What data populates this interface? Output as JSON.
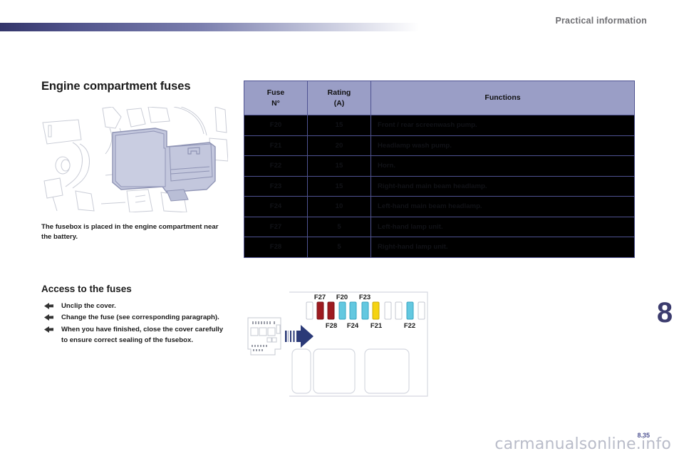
{
  "header": {
    "title": "Practical information"
  },
  "left": {
    "section_title": "Engine compartment fuses",
    "figure_caption": "The fusebox is placed in the engine compartment near the battery.",
    "access_title": "Access to the fuses",
    "steps": [
      "Unclip the cover.",
      "Change the fuse (see corresponding paragraph).",
      "When you have finished, close the cover carefully to ensure correct sealing of the fusebox."
    ]
  },
  "table": {
    "headers": {
      "fuse": "Fuse\nN°",
      "fuse_line1": "Fuse",
      "fuse_line2": "N°",
      "rating_line1": "Rating",
      "rating_line2": "(A)",
      "functions": "Functions"
    },
    "rows": [
      {
        "fuse": "F20",
        "rating": "15",
        "function": "Front / rear screenwash pump."
      },
      {
        "fuse": "F21",
        "rating": "20",
        "function": "Headlamp wash pump."
      },
      {
        "fuse": "F22",
        "rating": "15",
        "function": "Horn."
      },
      {
        "fuse": "F23",
        "rating": "15",
        "function": "Right-hand main beam headlamp."
      },
      {
        "fuse": "F24",
        "rating": "10",
        "function": "Left-hand main beam headlamp."
      },
      {
        "fuse": "F27",
        "rating": "5",
        "function": "Left-hand lamp unit."
      },
      {
        "fuse": "F28",
        "rating": "5",
        "function": "Right-hand lamp unit."
      }
    ]
  },
  "diagram": {
    "labels_top": [
      "F27",
      "F20",
      "F23"
    ],
    "labels_bottom": [
      "F28",
      "F24",
      "F21",
      "F22"
    ],
    "fuse_slots": [
      {
        "label": "",
        "color": "#ffffff"
      },
      {
        "label": "F27",
        "color": "#9e1b20"
      },
      {
        "label": "F28",
        "color": "#9e1b20"
      },
      {
        "label": "F20",
        "color": "#63c8e0"
      },
      {
        "label": "F24",
        "color": "#63c8e0"
      },
      {
        "label": "F23",
        "color": "#63c8e0"
      },
      {
        "label": "F21",
        "color": "#f5d312"
      },
      {
        "label": "",
        "color": "#ffffff"
      },
      {
        "label": "",
        "color": "#ffffff"
      },
      {
        "label": "F22",
        "color": "#63c8e0"
      },
      {
        "label": "",
        "color": "#ffffff"
      }
    ]
  },
  "chapter": {
    "number": "8"
  },
  "footer": {
    "page_number": "8.35",
    "watermark": "carmanualsonline.info"
  },
  "colors": {
    "header_gradient_start": "#33356a",
    "table_header_bg": "#9a9ec6",
    "table_border": "#4f5392",
    "chapter_number": "#3c3c6e",
    "fuse_red": "#9e1b20",
    "fuse_blue": "#63c8e0",
    "fuse_yellow": "#f5d312",
    "arrow_navy": "#2b3a78"
  }
}
